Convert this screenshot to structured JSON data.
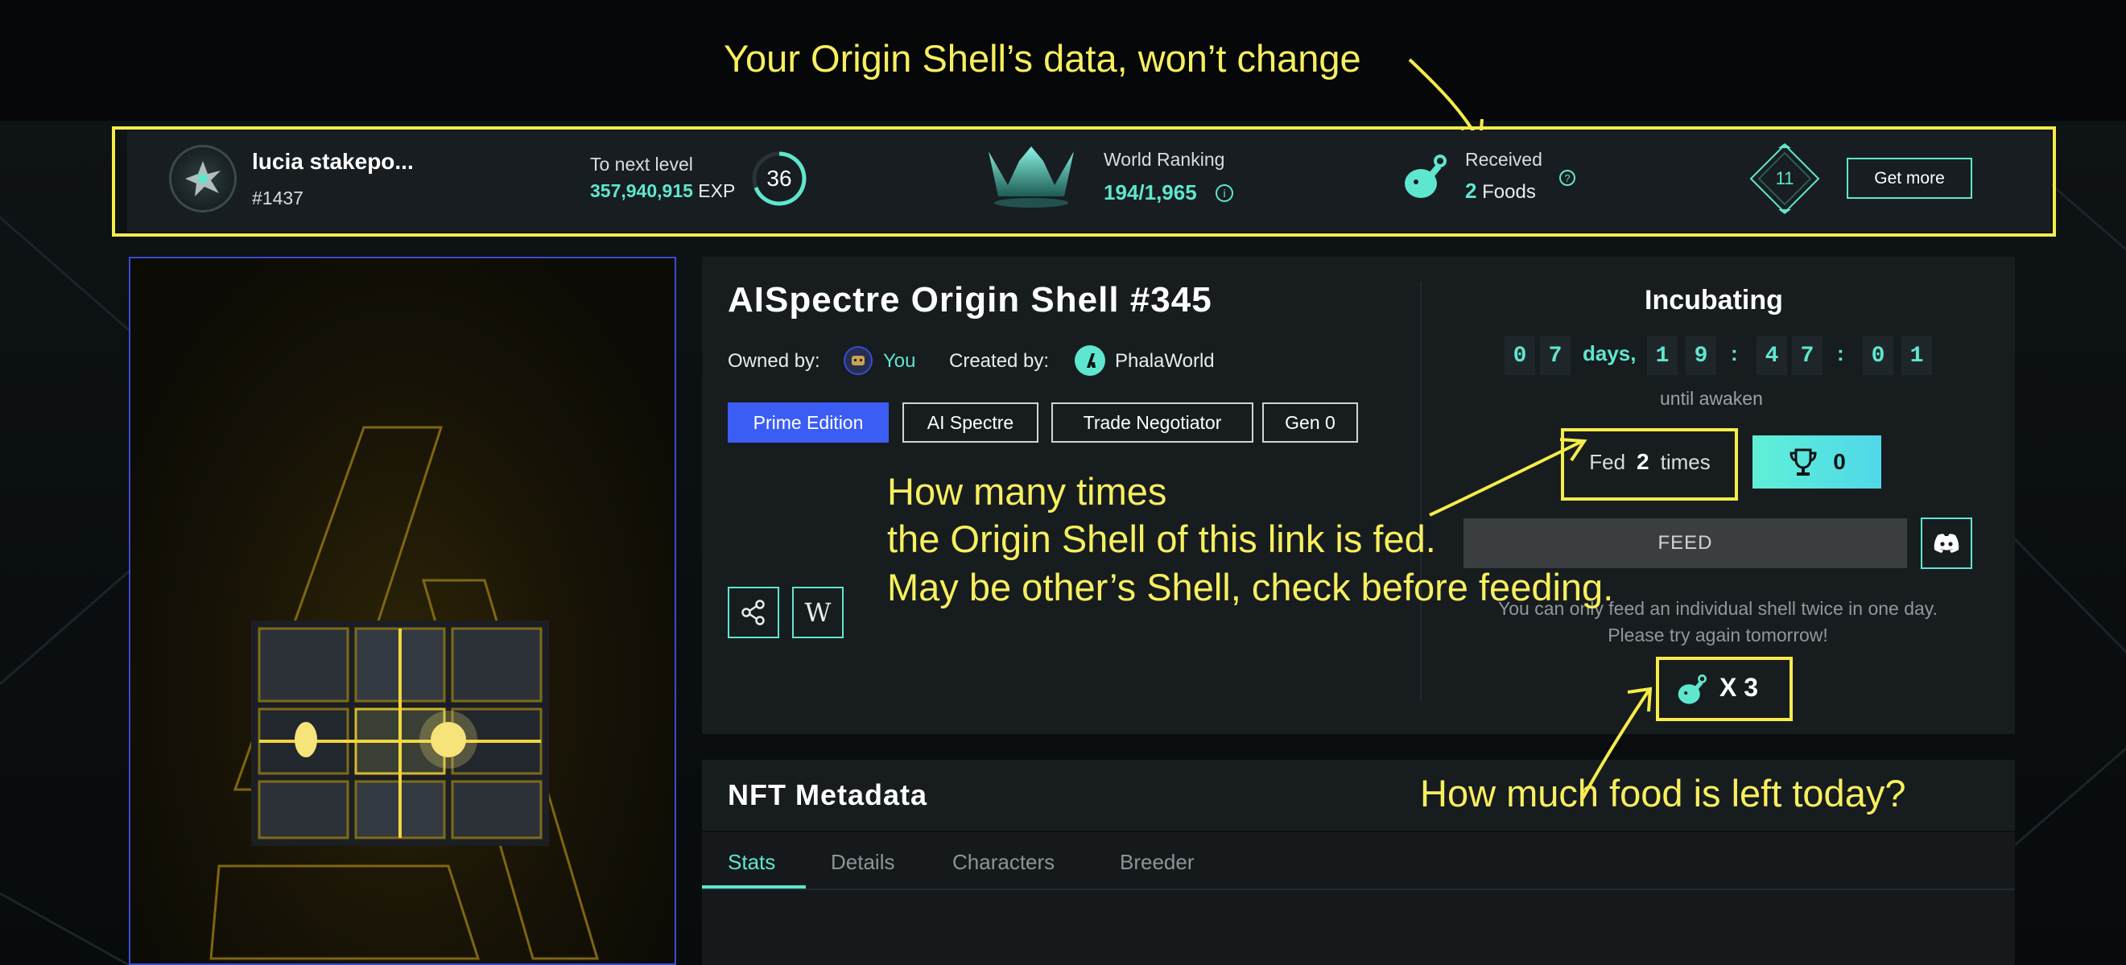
{
  "annotations": {
    "top": "Your Origin Shell’s data, won’t change",
    "middle_line1": "How many times",
    "middle_line2": "the Origin Shell of this link is fed.",
    "middle_line3": "May be other’s Shell, check before feeding.",
    "bottom": "How much food is left today?"
  },
  "header": {
    "username": "lucia stakepo...",
    "user_id": "#1437",
    "to_next_label": "To next level",
    "exp_value": "357,940,915",
    "exp_unit": "EXP",
    "level": "36",
    "ranking_label": "World Ranking",
    "ranking_value": "194/1,965",
    "received_label": "Received",
    "foods_count": "2",
    "foods_unit": "Foods",
    "badge_number": "11",
    "get_more_label": "Get more"
  },
  "nft": {
    "title": "AISpectre Origin Shell #345",
    "owned_label": "Owned by:",
    "owner": "You",
    "created_label": "Created by:",
    "creator": "PhalaWorld",
    "tags": [
      "Prime Edition",
      "AI Spectre",
      "Trade Negotiator",
      "Gen 0"
    ],
    "wiki_glyph": "W"
  },
  "incubation": {
    "status": "Incubating",
    "countdown": [
      "0",
      "7",
      "1",
      "9",
      "4",
      "7",
      "0",
      "1"
    ],
    "days_label": "days,",
    "separator": ":",
    "until_label": "until awaken",
    "fed_prefix": "Fed",
    "fed_count": "2",
    "fed_suffix": "times",
    "trophy_count": "0",
    "feed_button": "FEED",
    "feed_note_line1": "You can only feed an individual shell twice in one day.",
    "feed_note_line2": "Please try again tomorrow!",
    "food_left": "X 3"
  },
  "metadata": {
    "title": "NFT Metadata",
    "tabs": [
      "Stats",
      "Details",
      "Characters",
      "Breeder"
    ],
    "active_tab": "Stats"
  },
  "colors": {
    "accent": "#5fe6cf",
    "annotation": "#f5ec4a",
    "prime": "#3b5df3",
    "panel": "#171c1f",
    "nft_frame": "#3b4bd0"
  },
  "icons": {
    "avatar": "spectre-avatar-icon",
    "crown": "crown-icon",
    "food": "drumstick-icon",
    "share": "share-icon",
    "wiki": "wikipedia-icon",
    "trophy": "trophy-icon",
    "discord": "discord-icon",
    "badge": "diamond-badge-icon"
  }
}
